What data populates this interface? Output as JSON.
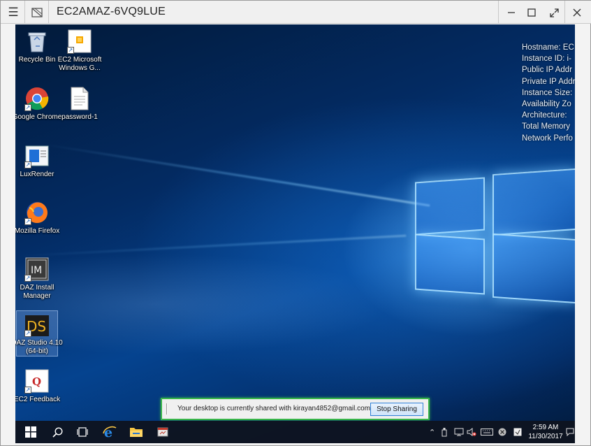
{
  "window": {
    "title": "EC2AMAZ-6VQ9LUE",
    "menu_icon": "hamburger-menu-icon",
    "pin_icon": "disconnect-icon",
    "controls": [
      "minimize-icon",
      "maximize-icon",
      "fit-screen-icon",
      "close-icon"
    ]
  },
  "desktop_icons": [
    {
      "label": "Recycle Bin",
      "icon": "recycle-bin-icon"
    },
    {
      "label": "EC2 Microsoft Windows G...",
      "icon": "ec2-guide-icon"
    },
    {
      "label": "Google Chrome",
      "icon": "chrome-icon"
    },
    {
      "label": "password-1",
      "icon": "text-file-icon"
    },
    {
      "label": "LuxRender",
      "icon": "luxrender-icon"
    },
    {
      "label": "Mozilla Firefox",
      "icon": "firefox-icon"
    },
    {
      "label": "DAZ Install Manager",
      "icon": "daz-install-manager-icon"
    },
    {
      "label": "DAZ Studio 4.10 (64-bit)",
      "icon": "daz-studio-icon"
    },
    {
      "label": "EC2 Feedback",
      "icon": "ec2-feedback-icon"
    }
  ],
  "instance_info": [
    "Hostname: EC",
    "Instance ID: i-",
    "Public IP Addr",
    "Private IP Addr",
    "Instance Size:",
    "Availability Zo",
    "Architecture:",
    "Total Memory",
    "Network Perfo"
  ],
  "sharing_bar": {
    "message": "Your desktop is currently shared with kirayan4852@gmail.com",
    "button": "Stop Sharing",
    "accent": "#39b54a"
  },
  "taskbar": {
    "clock_time": "2:59 AM",
    "clock_date": "11/30/2017"
  }
}
